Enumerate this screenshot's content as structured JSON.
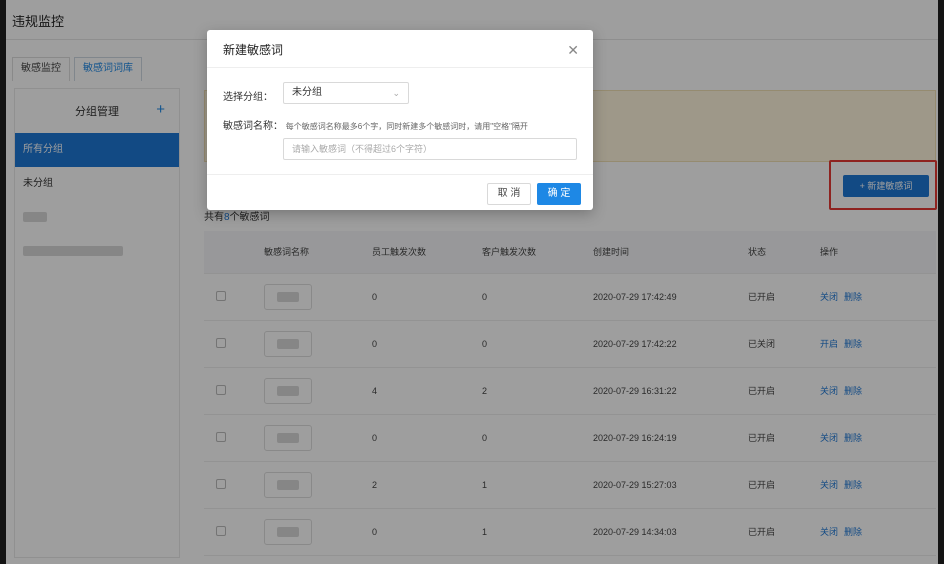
{
  "app": {
    "title": "违规监控"
  },
  "tabs": [
    {
      "label": "敏感监控",
      "active": false
    },
    {
      "label": "敏感词词库",
      "active": true
    }
  ],
  "sidebar": {
    "header": "分组管理",
    "add_icon": "plus-icon",
    "items": [
      {
        "label": "所有分组",
        "active": true
      },
      {
        "label": "未分组",
        "active": false
      }
    ]
  },
  "toolbar": {
    "new_button": "+ 新建敏感词"
  },
  "summary": {
    "prefix": "共有",
    "count": "8",
    "suffix": "个敏感词"
  },
  "table": {
    "headers": [
      "敏感词名称",
      "员工触发次数",
      "客户触发次数",
      "创建时间",
      "状态",
      "操作"
    ],
    "rows": [
      {
        "employee": "0",
        "customer": "0",
        "created": "2020-07-29 17:42:49",
        "status": "已开启",
        "toggle": "关闭",
        "delete": "删除"
      },
      {
        "employee": "0",
        "customer": "0",
        "created": "2020-07-29 17:42:22",
        "status": "已关闭",
        "toggle": "开启",
        "delete": "删除"
      },
      {
        "employee": "4",
        "customer": "2",
        "created": "2020-07-29 16:31:22",
        "status": "已开启",
        "toggle": "关闭",
        "delete": "删除"
      },
      {
        "employee": "0",
        "customer": "0",
        "created": "2020-07-29 16:24:19",
        "status": "已开启",
        "toggle": "关闭",
        "delete": "删除"
      },
      {
        "employee": "2",
        "customer": "1",
        "created": "2020-07-29 15:27:03",
        "status": "已开启",
        "toggle": "关闭",
        "delete": "删除"
      },
      {
        "employee": "0",
        "customer": "1",
        "created": "2020-07-29 14:34:03",
        "status": "已开启",
        "toggle": "关闭",
        "delete": "删除"
      }
    ]
  },
  "modal": {
    "title": "新建敏感词",
    "close_icon": "close-icon",
    "group_label": "选择分组：",
    "group_value": "未分组",
    "name_label": "敏感词名称：",
    "name_hint": "每个敏感词名称最多6个字，同时新建多个敏感词时，请用\"空格\"隔开",
    "name_placeholder": "请输入敏感词（不得超过6个字符）",
    "cancel": "取 消",
    "confirm": "确 定"
  },
  "colors": {
    "accent": "#1e78d6",
    "highlight_border": "#e53935",
    "notice_bg": "#fff5dd"
  }
}
